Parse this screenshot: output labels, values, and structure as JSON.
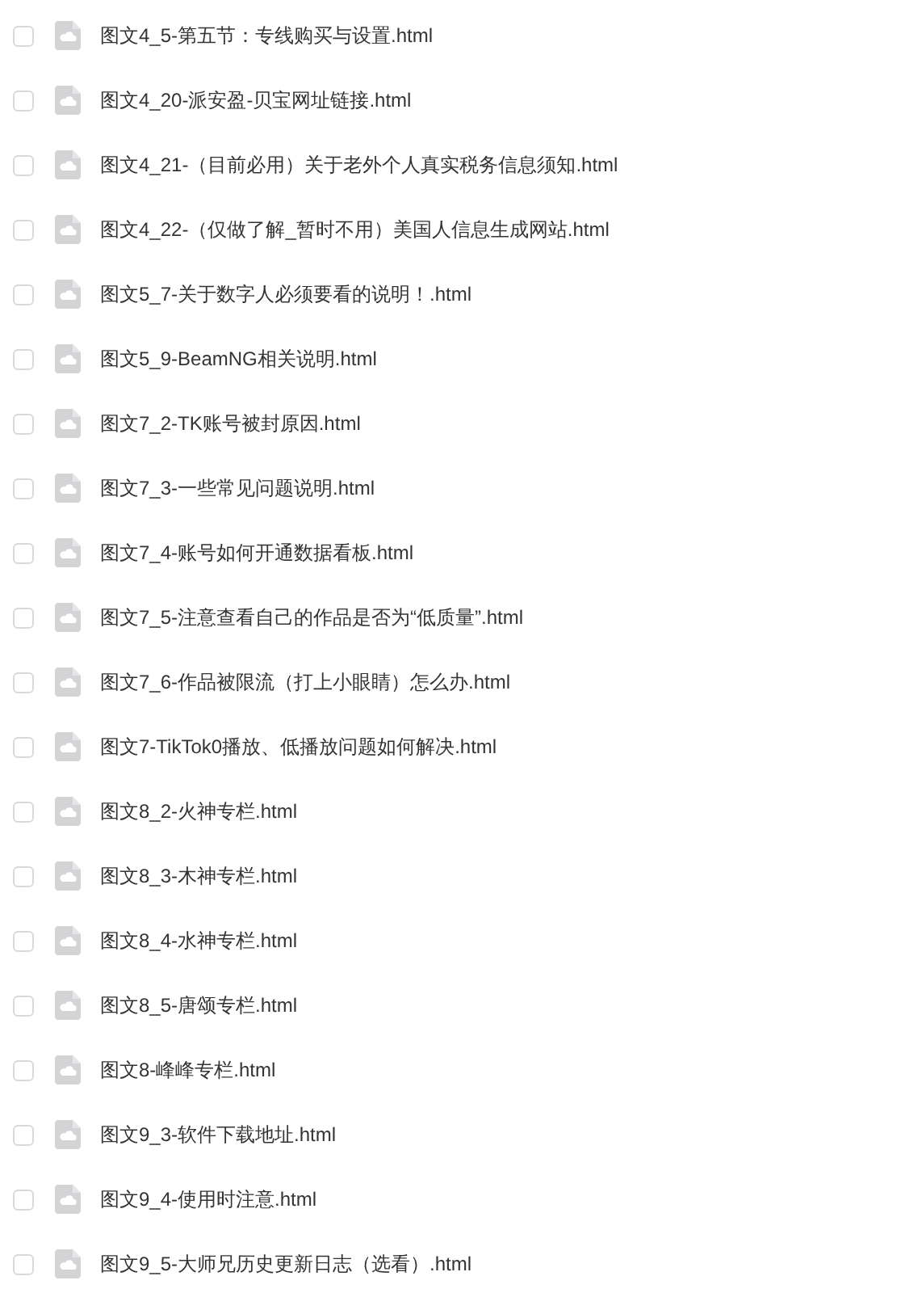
{
  "files": [
    {
      "name": "图文4_5-第五节：专线购买与设置.html",
      "checked": false
    },
    {
      "name": "图文4_20-派安盈-贝宝网址链接.html",
      "checked": false
    },
    {
      "name": "图文4_21-（目前必用）关于老外个人真实税务信息须知.html",
      "checked": false
    },
    {
      "name": "图文4_22-（仅做了解_暂时不用）美国人信息生成网站.html",
      "checked": false
    },
    {
      "name": "图文5_7-关于数字人必须要看的说明！.html",
      "checked": false
    },
    {
      "name": "图文5_9-BeamNG相关说明.html",
      "checked": false
    },
    {
      "name": "图文7_2-TK账号被封原因.html",
      "checked": false
    },
    {
      "name": "图文7_3-一些常见问题说明.html",
      "checked": false
    },
    {
      "name": "图文7_4-账号如何开通数据看板.html",
      "checked": false
    },
    {
      "name": "图文7_5-注意查看自己的作品是否为“低质量”.html",
      "checked": false
    },
    {
      "name": "图文7_6-作品被限流（打上小眼睛）怎么办.html",
      "checked": false
    },
    {
      "name": "图文7-TikTok0播放、低播放问题如何解决.html",
      "checked": false
    },
    {
      "name": "图文8_2-火神专栏.html",
      "checked": false
    },
    {
      "name": "图文8_3-木神专栏.html",
      "checked": false
    },
    {
      "name": "图文8_4-水神专栏.html",
      "checked": false
    },
    {
      "name": "图文8_5-唐颂专栏.html",
      "checked": false
    },
    {
      "name": "图文8-峰峰专栏.html",
      "checked": false
    },
    {
      "name": "图文9_3-软件下载地址.html",
      "checked": false
    },
    {
      "name": "图文9_4-使用时注意.html",
      "checked": false
    },
    {
      "name": "图文9_5-大师兄历史更新日志（选看）.html",
      "checked": false
    }
  ]
}
